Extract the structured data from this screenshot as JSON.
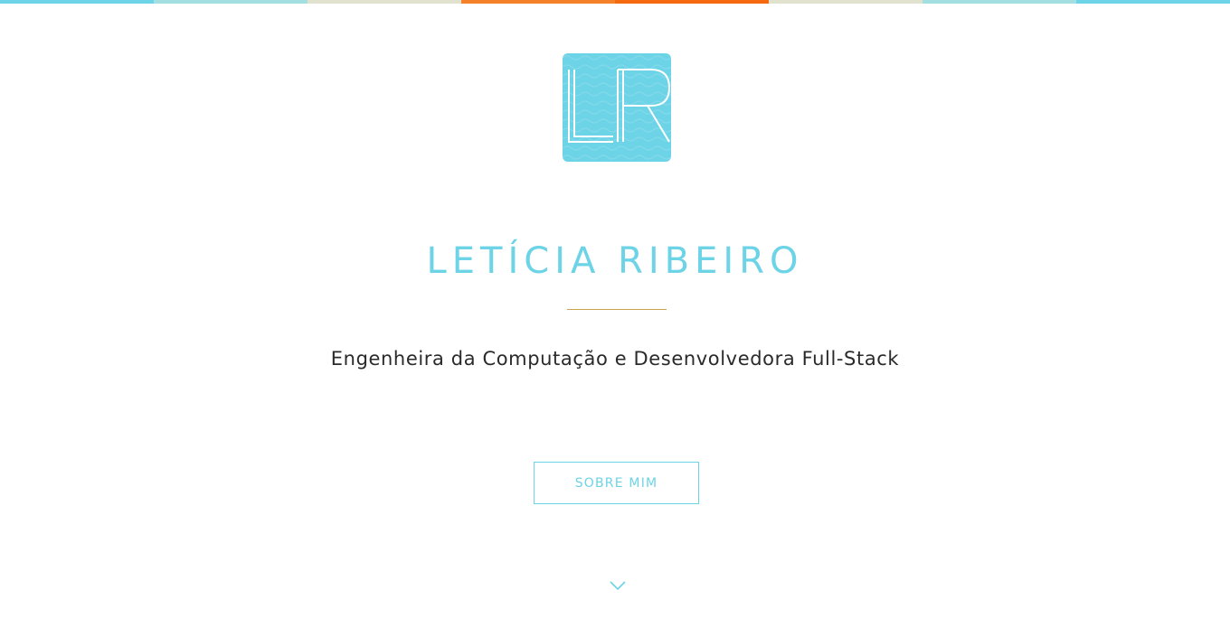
{
  "top_bar": {
    "colors": [
      "#6dd3e6",
      "#a3dfe0",
      "#e0e2cd",
      "#f5822a",
      "#f56a0f",
      "#e0e2cd",
      "#a3dfe0",
      "#6dd3e6"
    ]
  },
  "logo": {
    "monogram": "LR",
    "background_color": "#6dd3e6"
  },
  "hero": {
    "name": "LETÍCIA RIBEIRO",
    "subtitle": "Engenheira da Computação e Desenvolvedora Full-Stack",
    "about_button_label": "SOBRE MIM",
    "scroll_icon": "chevron-down-icon"
  },
  "colors": {
    "accent": "#6dd3e6",
    "divider": "#c9a24a",
    "text": "#2a2a2a"
  }
}
